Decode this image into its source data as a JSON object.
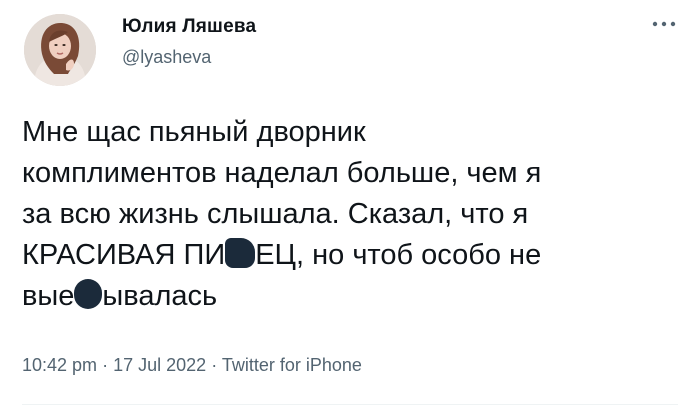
{
  "author": {
    "name": "Юлия Ляшева",
    "handle": "@lyasheva",
    "avatar_icon": "user-avatar"
  },
  "more_icon": "more-horizontal-icon",
  "tweet": {
    "lines": [
      {
        "text": "Мне щас пьяный дворник"
      },
      {
        "text": "комплиментов наделал больше, чем я"
      },
      {
        "text": "за всю жизнь слышала. Сказал, что я"
      },
      {
        "pre": "КРАСИВАЯ ПИ",
        "post": "ЕЦ, но чтоб особо не"
      },
      {
        "pre": "вые",
        "post": "ывалась"
      }
    ]
  },
  "meta": {
    "time": "10:42 pm",
    "sep1": "·",
    "date": "17 Jul 2022",
    "sep2": "·",
    "source": "Twitter for iPhone"
  },
  "colors": {
    "text": "#0f1419",
    "secondary": "#536471",
    "censor": "#1b2a3a"
  }
}
